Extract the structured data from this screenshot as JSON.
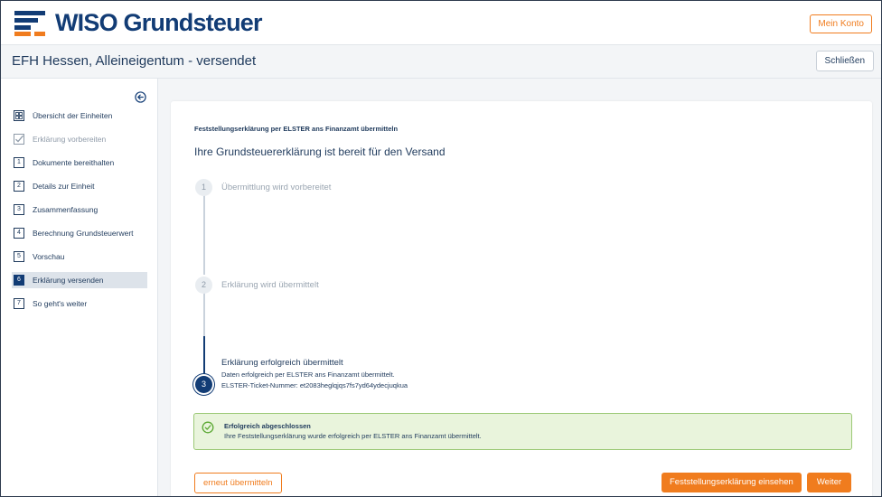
{
  "header": {
    "brand": "WISO Grundsteuer",
    "account_label": "Mein Konto"
  },
  "subheader": {
    "title": "EFH Hessen, Alleineigentum - versendet",
    "close_label": "Schließen"
  },
  "sidebar": {
    "items": [
      {
        "label": "Übersicht der Einheiten",
        "marker": ""
      },
      {
        "label": "Erklärung vorbereiten",
        "marker": ""
      },
      {
        "label": "Dokumente bereithalten",
        "marker": "1"
      },
      {
        "label": "Details zur Einheit",
        "marker": "2"
      },
      {
        "label": "Zusammenfassung",
        "marker": "3"
      },
      {
        "label": "Berechnung Grundsteuerwert",
        "marker": "4"
      },
      {
        "label": "Vorschau",
        "marker": "5"
      },
      {
        "label": "Erklärung versenden",
        "marker": "6"
      },
      {
        "label": "So geht's weiter",
        "marker": "7"
      }
    ]
  },
  "main": {
    "kicker": "Feststellungserklärung per ELSTER ans Finanzamt übermitteln",
    "title": "Ihre Grundsteuererklärung ist bereit für den Versand",
    "steps": [
      {
        "number": "1",
        "label": "Übermittlung wird vorbereitet"
      },
      {
        "number": "2",
        "label": "Erklärung wird übermittelt"
      },
      {
        "number": "3",
        "label": "Erklärung erfolgreich übermittelt",
        "detail": "Daten erfolgreich per ELSTER ans Finanzamt übermittelt.",
        "ticket": "ELSTER-Ticket-Nummer: et2083heglqjqs7fs7yd64ydecjuqkua"
      }
    ],
    "alert": {
      "title": "Erfolgreich abgeschlossen",
      "text": "Ihre Feststellungserklärung wurde erfolgreich per ELSTER ans Finanzamt übermittelt."
    },
    "buttons": {
      "resend": "erneut übermitteln",
      "view": "Feststellungserklärung einsehen",
      "next": "Weiter"
    }
  },
  "colors": {
    "brand_blue": "#123c75",
    "accent_orange": "#f07c1e",
    "success_bg": "#e9f4dc",
    "success_border": "#9cc976"
  },
  "icons": {
    "overview": "overview-icon",
    "prepare": "checkmark-icon",
    "collapse": "arrow-left-circle-icon",
    "success": "check-circle-icon"
  }
}
